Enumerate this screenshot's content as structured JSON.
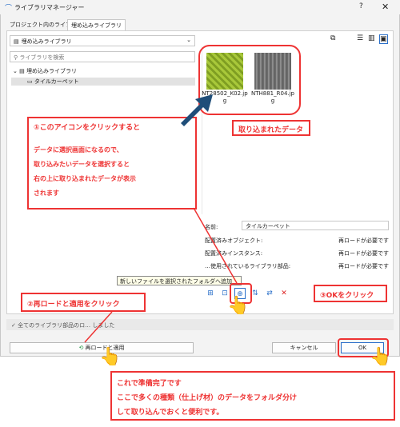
{
  "window": {
    "title": "ライブラリマネージャー",
    "help": "?",
    "close": "✕"
  },
  "tabs": [
    {
      "label": "プロジェクト内のライブラリ"
    },
    {
      "label": "埋め込みライブラリ"
    }
  ],
  "library_dropdown": {
    "value": "埋め込みライブラリ"
  },
  "search": {
    "placeholder": "ライブラリを検索"
  },
  "tree": {
    "root": "埋め込みライブラリ",
    "child": "タイルカーペット"
  },
  "thumbnails": [
    {
      "filename": "NT28502_K02.jpg"
    },
    {
      "filename": "NTH881_R04.jpg"
    }
  ],
  "properties": {
    "name_label": "名前:",
    "name_value": "タイルカーペット",
    "rows": [
      {
        "label": "配置済みオブジェクト:",
        "value": "再ロードが必要です"
      },
      {
        "label": "配置済みインスタンス:",
        "value": "再ロードが必要です"
      },
      {
        "label": "…使用されているライブラリ部品:",
        "value": "再ロードが必要です"
      }
    ]
  },
  "tooltip": "新しいファイルを選択されたフォルダへ追加",
  "status_bar": "✓ 全てのライブラリ部品のロ… しました",
  "buttons": {
    "reload": "再ロードと適用",
    "cancel": "キャンセル",
    "ok": "OK"
  },
  "annotations": {
    "a1_title": "①このアイコンをクリックすると",
    "a1_body": [
      "データに選択画面になるので、",
      "取り込みたいデータを選択すると",
      "右の上に取り込まれたデータが表示",
      "されます"
    ],
    "imported": "取り込まれたデータ",
    "a2": "②再ロードと適用をクリック",
    "a3": "③OKをクリック",
    "done": [
      "これで準備完了です",
      "ここで多くの種類（仕上げ材）のデータをフォルダ分け",
      "して取り込んでおくと便利です。"
    ]
  },
  "colors": {
    "annotation": "#e33333",
    "arrow": "#1f4e79"
  }
}
